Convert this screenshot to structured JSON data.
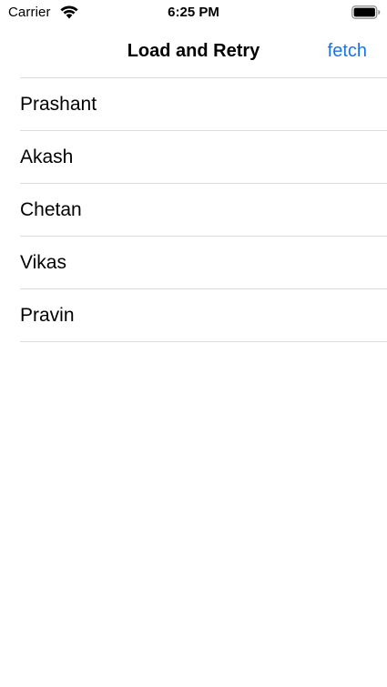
{
  "status_bar": {
    "carrier": "Carrier",
    "time": "6:25 PM",
    "wifi_icon": "wifi-icon",
    "battery_icon": "battery-full-icon"
  },
  "nav_bar": {
    "title": "Load and Retry",
    "right_button": "fetch"
  },
  "list": {
    "items": [
      {
        "label": "Prashant"
      },
      {
        "label": "Akash"
      },
      {
        "label": "Chetan"
      },
      {
        "label": "Vikas"
      },
      {
        "label": "Pravin"
      }
    ]
  },
  "colors": {
    "accent": "#1a73e8",
    "separator": "#dcdcdc",
    "background": "#ffffff",
    "text": "#000000"
  }
}
